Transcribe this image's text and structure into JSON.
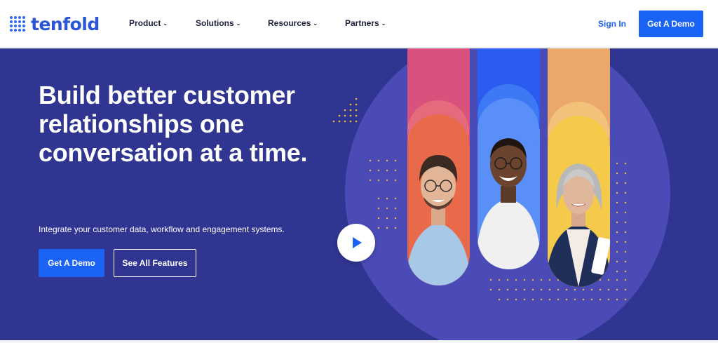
{
  "header": {
    "logo_text": "tenfold",
    "nav": [
      {
        "label": "Product"
      },
      {
        "label": "Solutions"
      },
      {
        "label": "Resources"
      },
      {
        "label": "Partners"
      }
    ],
    "sign_in_label": "Sign In",
    "cta_label": "Get A Demo"
  },
  "hero": {
    "headline": "Build better customer relationships one conversation at a time.",
    "subheadline": "Integrate your customer data, workflow and engagement systems.",
    "primary_button": "Get A Demo",
    "secondary_button": "See All Features",
    "play_icon": "play-icon"
  },
  "colors": {
    "brand_blue": "#1a63f5",
    "hero_bg": "#2f3590",
    "pill_pink": "#d9527e",
    "pill_blue": "#2a5cf2",
    "pill_orange": "#eba86a"
  }
}
